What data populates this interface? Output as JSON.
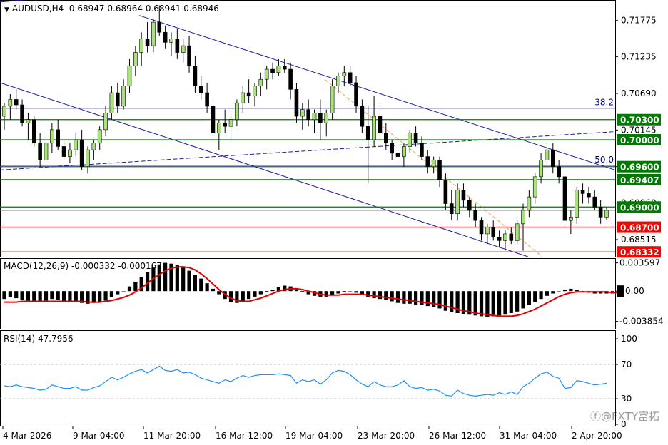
{
  "chart_data": {
    "type": "candlestick",
    "symbol": "AUDUSD,H4",
    "ohlc_header": [
      "0.68947",
      "0.68964",
      "0.68941",
      "0.68946"
    ],
    "price_axis": {
      "range": [
        0.6826,
        0.7208
      ],
      "tick_labels": [
        "0.71775",
        "0.71235",
        "0.70690",
        "0.70145",
        "0.69600",
        "0.69060",
        "0.68515"
      ]
    },
    "horizontal_levels": [
      {
        "label": "0.70300",
        "value": 0.703,
        "color": "#007a00",
        "box": true
      },
      {
        "label": "0.70000",
        "value": 0.7,
        "color": "#007a00",
        "box": true
      },
      {
        "label": "0.69600",
        "value": 0.696,
        "color": "#007a00",
        "box": true
      },
      {
        "label": "0.69407",
        "value": 0.69407,
        "color": "#007a00",
        "box": true
      },
      {
        "label": "0.69000",
        "value": 0.69,
        "color": "#007a00",
        "box": true
      },
      {
        "label": "0.68700",
        "value": 0.687,
        "color": "#ff0000",
        "box": true
      },
      {
        "label": "0.68332",
        "value": 0.68332,
        "color": "#ff0000",
        "box": true
      }
    ],
    "fib_levels": [
      {
        "label": "38.2",
        "value": 0.7047
      },
      {
        "label": "50.0",
        "value": 0.6962
      }
    ],
    "x_axis_labels": [
      "4 Mar 2026",
      "9 Mar 04:00",
      "11 Mar 20:00",
      "16 Mar 12:00",
      "19 Mar 04:00",
      "23 Mar 20:00",
      "26 Mar 12:00",
      "31 Mar 04:00",
      "2 Apr 20:00"
    ],
    "candles": [
      [
        0.7035,
        0.7055,
        0.7015,
        0.705
      ],
      [
        0.705,
        0.7068,
        0.703,
        0.706
      ],
      [
        0.706,
        0.7075,
        0.7045,
        0.7052
      ],
      [
        0.7052,
        0.706,
        0.702,
        0.7025
      ],
      [
        0.7025,
        0.704,
        0.7,
        0.703
      ],
      [
        0.703,
        0.7035,
        0.699,
        0.6995
      ],
      [
        0.6995,
        0.701,
        0.696,
        0.697
      ],
      [
        0.697,
        0.7,
        0.6965,
        0.6995
      ],
      [
        0.6995,
        0.7025,
        0.698,
        0.7015
      ],
      [
        0.7015,
        0.703,
        0.6985,
        0.699
      ],
      [
        0.699,
        0.7,
        0.697,
        0.6975
      ],
      [
        0.6975,
        0.6995,
        0.6965,
        0.6985
      ],
      [
        0.6985,
        0.701,
        0.6975,
        0.7
      ],
      [
        0.7,
        0.7015,
        0.6955,
        0.696
      ],
      [
        0.696,
        0.699,
        0.695,
        0.6985
      ],
      [
        0.6985,
        0.7,
        0.697,
        0.6995
      ],
      [
        0.6995,
        0.702,
        0.6985,
        0.7015
      ],
      [
        0.7015,
        0.705,
        0.7005,
        0.704
      ],
      [
        0.704,
        0.708,
        0.703,
        0.707
      ],
      [
        0.707,
        0.7085,
        0.704,
        0.705
      ],
      [
        0.705,
        0.709,
        0.7045,
        0.708
      ],
      [
        0.708,
        0.712,
        0.707,
        0.711
      ],
      [
        0.711,
        0.714,
        0.7095,
        0.713
      ],
      [
        0.713,
        0.716,
        0.711,
        0.715
      ],
      [
        0.715,
        0.7175,
        0.713,
        0.714
      ],
      [
        0.714,
        0.718,
        0.713,
        0.7175
      ],
      [
        0.7175,
        0.72,
        0.7155,
        0.716
      ],
      [
        0.716,
        0.717,
        0.7135,
        0.7145
      ],
      [
        0.7145,
        0.716,
        0.7125,
        0.715
      ],
      [
        0.715,
        0.7165,
        0.712,
        0.713
      ],
      [
        0.713,
        0.715,
        0.7115,
        0.714
      ],
      [
        0.714,
        0.7155,
        0.71,
        0.711
      ],
      [
        0.711,
        0.7125,
        0.707,
        0.708
      ],
      [
        0.708,
        0.7095,
        0.706,
        0.707
      ],
      [
        0.707,
        0.7085,
        0.704,
        0.705
      ],
      [
        0.705,
        0.706,
        0.7,
        0.701
      ],
      [
        0.701,
        0.703,
        0.6985,
        0.7025
      ],
      [
        0.7025,
        0.7045,
        0.701,
        0.702
      ],
      [
        0.702,
        0.704,
        0.7,
        0.703
      ],
      [
        0.703,
        0.706,
        0.702,
        0.7055
      ],
      [
        0.7055,
        0.708,
        0.704,
        0.707
      ],
      [
        0.707,
        0.709,
        0.7055,
        0.7065
      ],
      [
        0.7065,
        0.7085,
        0.705,
        0.708
      ],
      [
        0.708,
        0.71,
        0.7065,
        0.709
      ],
      [
        0.709,
        0.711,
        0.7075,
        0.7105
      ],
      [
        0.7105,
        0.7115,
        0.709,
        0.71
      ],
      [
        0.71,
        0.712,
        0.7095,
        0.711
      ],
      [
        0.711,
        0.712,
        0.71,
        0.7105
      ],
      [
        0.7105,
        0.7115,
        0.706,
        0.7075
      ],
      [
        0.7075,
        0.7085,
        0.7025,
        0.7035
      ],
      [
        0.7035,
        0.7055,
        0.7015,
        0.7045
      ],
      [
        0.7045,
        0.706,
        0.702,
        0.703
      ],
      [
        0.703,
        0.7045,
        0.701,
        0.704
      ],
      [
        0.704,
        0.706,
        0.7,
        0.7025
      ],
      [
        0.7025,
        0.7045,
        0.7005,
        0.704
      ],
      [
        0.704,
        0.709,
        0.703,
        0.708
      ],
      [
        0.708,
        0.71,
        0.707,
        0.7095
      ],
      [
        0.7095,
        0.711,
        0.708,
        0.71
      ],
      [
        0.71,
        0.711,
        0.708,
        0.7085
      ],
      [
        0.7085,
        0.7095,
        0.704,
        0.705
      ],
      [
        0.705,
        0.706,
        0.701,
        0.702
      ],
      [
        0.702,
        0.705,
        0.6935,
        0.7
      ],
      [
        0.7,
        0.7065,
        0.699,
        0.7035
      ],
      [
        0.7035,
        0.705,
        0.7,
        0.701
      ],
      [
        0.701,
        0.7025,
        0.6985,
        0.6995
      ],
      [
        0.6995,
        0.7,
        0.697,
        0.698
      ],
      [
        0.698,
        0.699,
        0.6965,
        0.6975
      ],
      [
        0.6975,
        0.6995,
        0.696,
        0.699
      ],
      [
        0.699,
        0.7015,
        0.698,
        0.701
      ],
      [
        0.701,
        0.702,
        0.699,
        0.6995
      ],
      [
        0.6995,
        0.7005,
        0.697,
        0.6975
      ],
      [
        0.6975,
        0.6985,
        0.695,
        0.696
      ],
      [
        0.696,
        0.6975,
        0.695,
        0.697
      ],
      [
        0.697,
        0.6975,
        0.693,
        0.694
      ],
      [
        0.694,
        0.695,
        0.6895,
        0.6905
      ],
      [
        0.6905,
        0.6925,
        0.688,
        0.689
      ],
      [
        0.689,
        0.6935,
        0.688,
        0.6925
      ],
      [
        0.6925,
        0.6935,
        0.69,
        0.691
      ],
      [
        0.691,
        0.6915,
        0.6885,
        0.6895
      ],
      [
        0.6895,
        0.6905,
        0.687,
        0.688
      ],
      [
        0.688,
        0.6885,
        0.685,
        0.686
      ],
      [
        0.686,
        0.6875,
        0.6845,
        0.687
      ],
      [
        0.687,
        0.688,
        0.685,
        0.6855
      ],
      [
        0.6855,
        0.6865,
        0.684,
        0.685
      ],
      [
        0.685,
        0.6865,
        0.6835,
        0.686
      ],
      [
        0.686,
        0.687,
        0.6845,
        0.685
      ],
      [
        0.685,
        0.688,
        0.6845,
        0.6875
      ],
      [
        0.6875,
        0.6905,
        0.6835,
        0.6895
      ],
      [
        0.6895,
        0.6925,
        0.6885,
        0.6915
      ],
      [
        0.6915,
        0.695,
        0.6905,
        0.6945
      ],
      [
        0.6945,
        0.698,
        0.6935,
        0.697
      ],
      [
        0.697,
        0.6995,
        0.696,
        0.6985
      ],
      [
        0.6985,
        0.6995,
        0.695,
        0.696
      ],
      [
        0.696,
        0.697,
        0.6935,
        0.6945
      ],
      [
        0.6945,
        0.6955,
        0.687,
        0.688
      ],
      [
        0.688,
        0.6895,
        0.686,
        0.6885
      ],
      [
        0.6885,
        0.693,
        0.6875,
        0.6925
      ],
      [
        0.6925,
        0.6935,
        0.6905,
        0.692
      ],
      [
        0.692,
        0.693,
        0.6905,
        0.6915
      ],
      [
        0.6915,
        0.6925,
        0.6895,
        0.69
      ],
      [
        0.69,
        0.691,
        0.6875,
        0.6885
      ],
      [
        0.6885,
        0.69,
        0.688,
        0.6895
      ]
    ],
    "macd": {
      "label": "MACD(12,26,9) -0.000332 -0.000167",
      "axis_labels": [
        "0.003597",
        "0.00",
        "-0.003854"
      ],
      "range": [
        -0.0048,
        0.0042
      ],
      "histogram": [
        -0.001,
        -0.0008,
        -0.0009,
        -0.0011,
        -0.0012,
        -0.0013,
        -0.0014,
        -0.0012,
        -0.001,
        -0.0011,
        -0.0013,
        -0.0014,
        -0.0013,
        -0.0015,
        -0.0016,
        -0.0015,
        -0.0014,
        -0.0012,
        -0.0008,
        -0.0004,
        0.0,
        0.0006,
        0.0012,
        0.0018,
        0.0024,
        0.003,
        0.0034,
        0.0036,
        0.0035,
        0.0033,
        0.003,
        0.0026,
        0.0021,
        0.0016,
        0.001,
        0.0003,
        -0.0004,
        -0.001,
        -0.0014,
        -0.0015,
        -0.0013,
        -0.001,
        -0.0007,
        -0.0004,
        -0.0001,
        0.0002,
        0.0005,
        0.0007,
        0.0006,
        0.0003,
        -0.0001,
        -0.0004,
        -0.0006,
        -0.0007,
        -0.0007,
        -0.0005,
        -0.0003,
        -0.0001,
        0.0,
        -0.0002,
        -0.0005,
        -0.0007,
        -0.0009,
        -0.001,
        -0.0011,
        -0.0013,
        -0.0015,
        -0.0016,
        -0.0016,
        -0.0017,
        -0.0018,
        -0.0019,
        -0.002,
        -0.0022,
        -0.0025,
        -0.0027,
        -0.0028,
        -0.0029,
        -0.003,
        -0.0031,
        -0.0032,
        -0.0033,
        -0.0032,
        -0.0031,
        -0.003,
        -0.0028,
        -0.0026,
        -0.0022,
        -0.0018,
        -0.0014,
        -0.001,
        -0.0006,
        -0.0003,
        0.0,
        0.0002,
        0.0003,
        0.0002,
        -0.0001,
        -0.0002,
        -0.0003,
        -0.0003,
        -0.0003,
        -0.0003,
        -0.0003
      ],
      "signal": [
        -0.0014,
        -0.0014,
        -0.0014,
        -0.0013,
        -0.0013,
        -0.0013,
        -0.0013,
        -0.0013,
        -0.0013,
        -0.0013,
        -0.0013,
        -0.0013,
        -0.0013,
        -0.0013,
        -0.0014,
        -0.0014,
        -0.0014,
        -0.0013,
        -0.0012,
        -0.001,
        -0.0008,
        -0.0005,
        -0.0001,
        0.0004,
        0.001,
        0.0016,
        0.0021,
        0.0026,
        0.0029,
        0.0031,
        0.0031,
        0.003,
        0.0027,
        0.0022,
        0.0016,
        0.0009,
        0.0002,
        -0.0004,
        -0.0009,
        -0.0012,
        -0.0013,
        -0.0013,
        -0.0011,
        -0.0009,
        -0.0006,
        -0.0003,
        0.0,
        0.0002,
        0.0003,
        0.0003,
        0.0002,
        0.0,
        -0.0002,
        -0.0004,
        -0.0005,
        -0.0005,
        -0.0005,
        -0.0004,
        -0.0004,
        -0.0004,
        -0.0004,
        -0.0005,
        -0.0006,
        -0.0007,
        -0.0008,
        -0.0009,
        -0.001,
        -0.0011,
        -0.0012,
        -0.0013,
        -0.0014,
        -0.0015,
        -0.0016,
        -0.0017,
        -0.0019,
        -0.0021,
        -0.0023,
        -0.0025,
        -0.0026,
        -0.0028,
        -0.0029,
        -0.003,
        -0.0031,
        -0.0032,
        -0.0032,
        -0.0032,
        -0.0031,
        -0.0029,
        -0.0026,
        -0.0023,
        -0.0019,
        -0.0015,
        -0.0011,
        -0.0007,
        -0.0004,
        -0.0002,
        -0.0001,
        -0.0001,
        -0.0001,
        -0.0001,
        -0.0001,
        -0.0001,
        -0.0002,
        -0.0002
      ]
    },
    "rsi": {
      "label": "RSI(14) 47.7956",
      "axis_labels": [
        "100",
        "70",
        "30",
        "0"
      ],
      "range": [
        0,
        100
      ],
      "levels": [
        70,
        30
      ],
      "values": [
        45,
        44,
        46,
        44,
        43,
        42,
        40,
        41,
        46,
        44,
        42,
        42,
        44,
        40,
        40,
        43,
        45,
        50,
        55,
        52,
        55,
        59,
        62,
        64,
        60,
        64,
        68,
        63,
        62,
        64,
        60,
        61,
        58,
        54,
        52,
        50,
        48,
        52,
        50,
        54,
        57,
        55,
        57,
        58,
        58,
        58,
        59,
        58,
        57,
        48,
        52,
        50,
        52,
        47,
        52,
        60,
        63,
        62,
        58,
        52,
        47,
        44,
        50,
        46,
        44,
        44,
        46,
        51,
        44,
        42,
        43,
        40,
        41,
        39,
        34,
        33,
        40,
        36,
        34,
        33,
        34,
        35,
        34,
        37,
        35,
        38,
        35,
        44,
        48,
        54,
        59,
        61,
        56,
        54,
        42,
        43,
        51,
        50,
        48,
        46,
        47,
        48
      ]
    },
    "watermark": "@FXTY富拓"
  }
}
